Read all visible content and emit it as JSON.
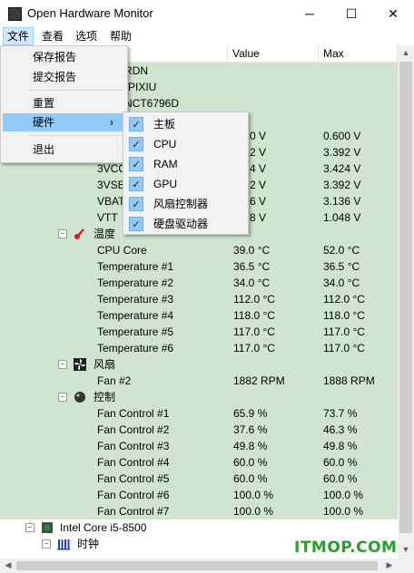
{
  "window": {
    "title": "Open Hardware Monitor",
    "minimize_icon": "─",
    "maximize_icon": "☐",
    "close_icon": "✕"
  },
  "menubar": [
    "文件",
    "查看",
    "选项",
    "帮助"
  ],
  "columns": {
    "value": "Value",
    "max": "Max"
  },
  "partial_rows": [
    {
      "text": "RDN"
    },
    {
      "text": "-PIXIU"
    },
    {
      "text": "NCT6796D"
    }
  ],
  "rows": [
    {
      "sensor": "",
      "value": "0 V",
      "max": "0.600 V"
    },
    {
      "sensor": "",
      "value": "2 V",
      "max": "3.392 V"
    },
    {
      "sensor": "3VCC",
      "value": "4 V",
      "max": "3.424 V"
    },
    {
      "sensor": "3VSB",
      "value": "2 V",
      "max": "3.392 V"
    },
    {
      "sensor": "VBAT",
      "value": "6 V",
      "max": "3.136 V"
    },
    {
      "sensor": "VTT",
      "value": "8 V",
      "max": "1.048 V"
    }
  ],
  "categories": {
    "temperature": "温度",
    "fans": "风扇",
    "controls": "控制",
    "clock": "时钟"
  },
  "temperatures": [
    {
      "sensor": "CPU Core",
      "value": "39.0 °C",
      "max": "52.0 °C"
    },
    {
      "sensor": "Temperature #1",
      "value": "36.5 °C",
      "max": "36.5 °C"
    },
    {
      "sensor": "Temperature #2",
      "value": "34.0 °C",
      "max": "34.0 °C"
    },
    {
      "sensor": "Temperature #3",
      "value": "112.0 °C",
      "max": "112.0 °C"
    },
    {
      "sensor": "Temperature #4",
      "value": "118.0 °C",
      "max": "118.0 °C"
    },
    {
      "sensor": "Temperature #5",
      "value": "117.0 °C",
      "max": "117.0 °C"
    },
    {
      "sensor": "Temperature #6",
      "value": "117.0 °C",
      "max": "117.0 °C"
    }
  ],
  "fans": [
    {
      "sensor": "Fan #2",
      "value": "1882 RPM",
      "max": "1888 RPM"
    }
  ],
  "controls": [
    {
      "sensor": "Fan Control #1",
      "value": "65.9 %",
      "max": "73.7 %"
    },
    {
      "sensor": "Fan Control #2",
      "value": "37.6 %",
      "max": "46.3 %"
    },
    {
      "sensor": "Fan Control #3",
      "value": "49.8 %",
      "max": "49.8 %"
    },
    {
      "sensor": "Fan Control #4",
      "value": "60.0 %",
      "max": "60.0 %"
    },
    {
      "sensor": "Fan Control #5",
      "value": "60.0 %",
      "max": "60.0 %"
    },
    {
      "sensor": "Fan Control #6",
      "value": "100.0 %",
      "max": "100.0 %"
    },
    {
      "sensor": "Fan Control #7",
      "value": "100.0 %",
      "max": "100.0 %"
    }
  ],
  "cpu": {
    "name": "Intel Core i5-8500"
  },
  "file_menu": {
    "save_report": "保存报告",
    "submit_report": "提交报告",
    "reset": "重置",
    "hardware": "硬件",
    "exit": "退出",
    "submenu_arrow": "›"
  },
  "hardware_submenu": [
    {
      "label": "主板",
      "checked": true
    },
    {
      "label": "CPU",
      "checked": true
    },
    {
      "label": "RAM",
      "checked": true
    },
    {
      "label": "GPU",
      "checked": true
    },
    {
      "label": "风扇控制器",
      "checked": true
    },
    {
      "label": "硬盘驱动器",
      "checked": true
    }
  ],
  "watermark": "ITMOP.COM"
}
